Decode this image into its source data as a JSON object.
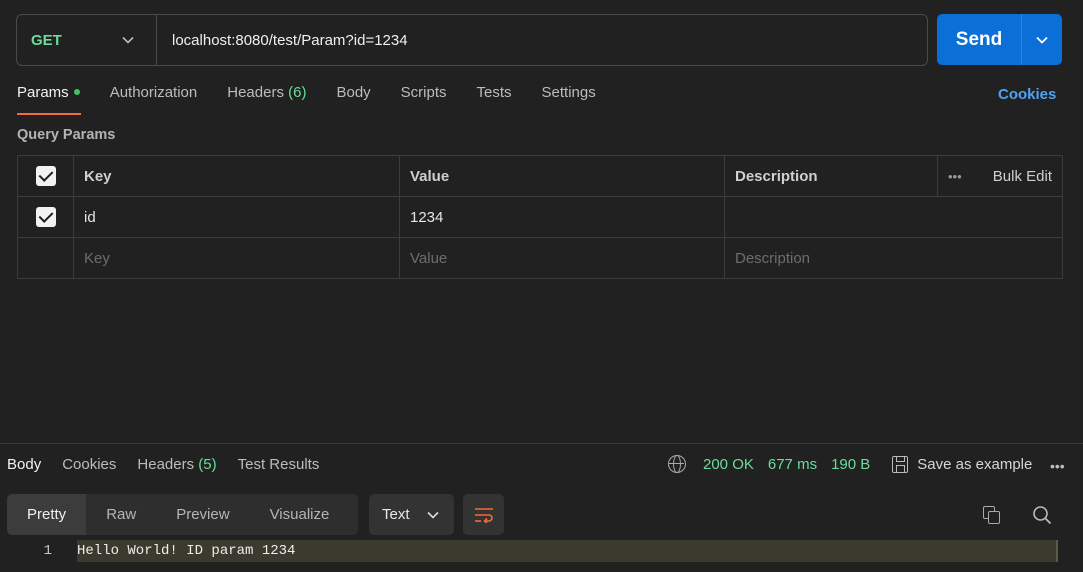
{
  "request": {
    "method": "GET",
    "url": "localhost:8080/test/Param?id=1234",
    "send_label": "Send"
  },
  "request_tabs": {
    "params": "Params",
    "authorization": "Authorization",
    "headers": "Headers",
    "headers_count": "(6)",
    "body": "Body",
    "scripts": "Scripts",
    "tests": "Tests",
    "settings": "Settings",
    "cookies": "Cookies"
  },
  "query_params": {
    "section_title": "Query Params",
    "headers": {
      "key": "Key",
      "value": "Value",
      "description": "Description",
      "more": "•••",
      "bulk_edit": "Bulk Edit"
    },
    "rows": [
      {
        "checked": true,
        "key": "id",
        "value": "1234",
        "description": ""
      }
    ],
    "placeholder": {
      "key": "Key",
      "value": "Value",
      "description": "Description"
    }
  },
  "response": {
    "tabs": {
      "body": "Body",
      "cookies": "Cookies",
      "headers": "Headers",
      "headers_count": "(5)",
      "test_results": "Test Results"
    },
    "status": "200 OK",
    "time": "677 ms",
    "size": "190 B",
    "save_example": "Save as example",
    "more": "•••",
    "view_modes": [
      "Pretty",
      "Raw",
      "Preview",
      "Visualize"
    ],
    "format": "Text",
    "lines": [
      {
        "number": "1",
        "text": "Hello World! ID param 1234"
      }
    ]
  },
  "colors": {
    "accent_orange": "#f26b3a",
    "method_green": "#6bdd9a",
    "send_blue": "#0a6fd6",
    "link_blue": "#4da3f7"
  },
  "icons": [
    "chevron-down-icon",
    "checkbox-checked-icon",
    "globe-icon",
    "save-icon",
    "wrap-lines-icon",
    "copy-icon",
    "search-icon",
    "more-icon"
  ]
}
